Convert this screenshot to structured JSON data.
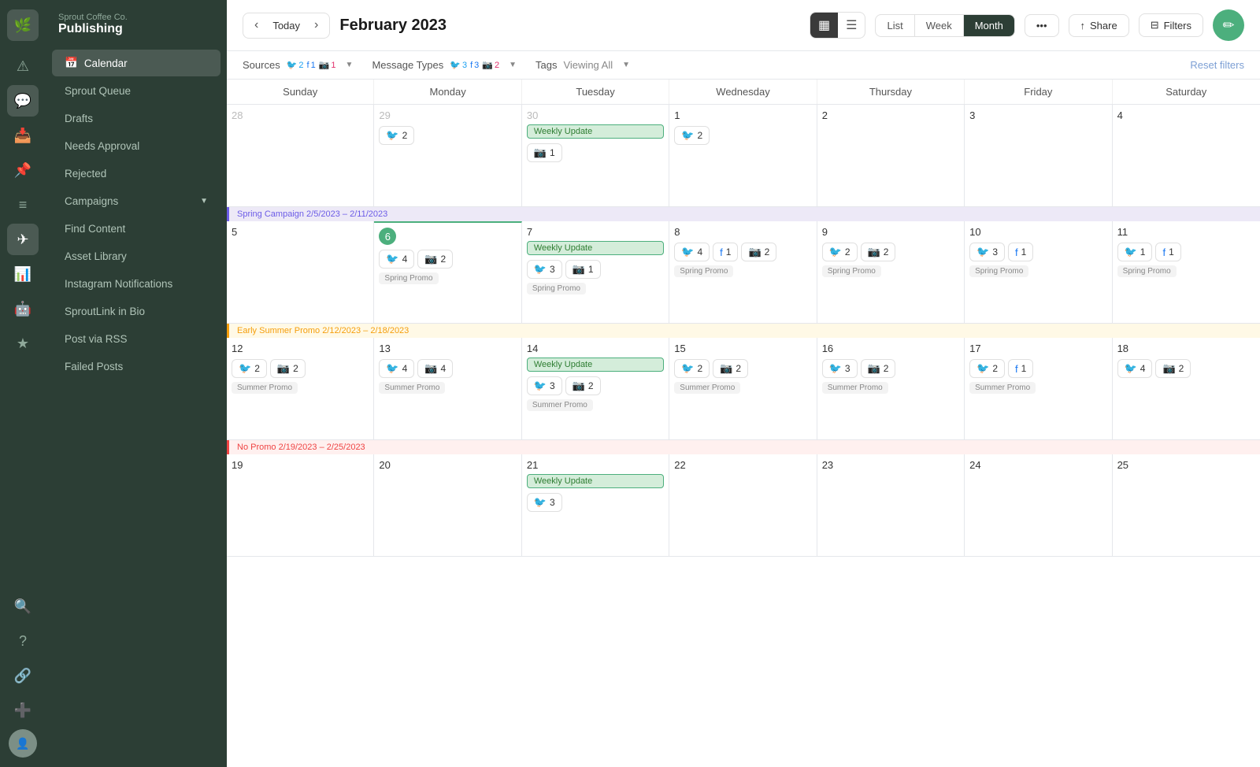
{
  "brand": {
    "company": "Sprout Coffee Co.",
    "app": "Publishing"
  },
  "nav": {
    "items": [
      {
        "id": "calendar",
        "label": "Calendar",
        "active": true
      },
      {
        "id": "sprout-queue",
        "label": "Sprout Queue",
        "active": false
      },
      {
        "id": "drafts",
        "label": "Drafts",
        "active": false
      },
      {
        "id": "needs-approval",
        "label": "Needs Approval",
        "active": false
      },
      {
        "id": "rejected",
        "label": "Rejected",
        "active": false
      },
      {
        "id": "campaigns",
        "label": "Campaigns",
        "active": false,
        "hasChevron": true
      },
      {
        "id": "find-content",
        "label": "Find Content",
        "active": false
      },
      {
        "id": "asset-library",
        "label": "Asset Library",
        "active": false
      },
      {
        "id": "instagram-notifications",
        "label": "Instagram Notifications",
        "active": false
      },
      {
        "id": "sproutlink",
        "label": "SproutLink in Bio",
        "active": false
      },
      {
        "id": "post-via-rss",
        "label": "Post via RSS",
        "active": false
      },
      {
        "id": "failed-posts",
        "label": "Failed Posts",
        "active": false
      }
    ]
  },
  "header": {
    "month_title": "February 2023",
    "today_label": "Today",
    "view_options": [
      "List",
      "Week",
      "Month"
    ],
    "active_view": "Month",
    "share_label": "Share",
    "filters_label": "Filters"
  },
  "filters": {
    "sources_label": "Sources",
    "sources_twitter": "2",
    "sources_facebook": "1",
    "sources_instagram": "1",
    "message_types_label": "Message Types",
    "mt_twitter": "3",
    "mt_facebook": "3",
    "mt_instagram": "2",
    "tags_label": "Tags",
    "tags_value": "Viewing All",
    "reset_label": "Reset filters"
  },
  "days_of_week": [
    "Sunday",
    "Monday",
    "Tuesday",
    "Wednesday",
    "Thursday",
    "Friday",
    "Saturday"
  ],
  "campaigns": {
    "spring": "Spring Campaign 2/5/2023 – 2/11/2023",
    "early_summer": "Early Summer Promo 2/12/2023 – 2/18/2023",
    "no_promo": "No Promo 2/19/2023 – 2/25/2023"
  },
  "weeks": [
    {
      "id": "week0",
      "days": [
        {
          "date": "28",
          "other_month": true,
          "posts": []
        },
        {
          "date": "29",
          "other_month": true,
          "posts": [
            {
              "type": "tw",
              "count": "2"
            }
          ]
        },
        {
          "date": "30",
          "other_month": true,
          "has_event": true,
          "event_label": "Weekly Update",
          "posts": [
            {
              "type": "ig",
              "count": "1"
            }
          ]
        },
        {
          "date": "1",
          "other_month": false,
          "posts": [
            {
              "type": "tw",
              "count": "2"
            }
          ]
        },
        {
          "date": "2",
          "other_month": false,
          "posts": []
        },
        {
          "date": "3",
          "other_month": false,
          "posts": []
        },
        {
          "date": "4",
          "other_month": false,
          "posts": []
        }
      ]
    },
    {
      "id": "week1",
      "campaign": {
        "label": "Spring Campaign 2/5/2023 – 2/11/2023",
        "type": "spring",
        "startCol": 1,
        "endCol": 7
      },
      "days": [
        {
          "date": "5",
          "other_month": false,
          "posts": []
        },
        {
          "date": "6",
          "other_month": false,
          "today": true,
          "posts": [
            {
              "type": "tw",
              "count": "4"
            },
            {
              "type": "ig",
              "count": "2",
              "promo": "Spring Promo"
            }
          ]
        },
        {
          "date": "7",
          "other_month": false,
          "has_event": true,
          "event_label": "Weekly Update",
          "posts": [
            {
              "type": "tw",
              "count": "3"
            },
            {
              "type": "ig",
              "count": "1",
              "promo": "Spring Promo"
            }
          ]
        },
        {
          "date": "8",
          "other_month": false,
          "posts": [
            {
              "type": "tw",
              "count": "4"
            },
            {
              "type": "fb",
              "count": "1"
            },
            {
              "type": "ig",
              "count": "2",
              "promo": "Spring Promo"
            }
          ]
        },
        {
          "date": "9",
          "other_month": false,
          "posts": [
            {
              "type": "tw",
              "count": "2"
            },
            {
              "type": "ig",
              "count": "2",
              "promo": "Spring Promo"
            }
          ]
        },
        {
          "date": "10",
          "other_month": false,
          "posts": [
            {
              "type": "tw",
              "count": "3"
            },
            {
              "type": "fb",
              "count": "1",
              "promo": "Spring Promo"
            }
          ]
        },
        {
          "date": "11",
          "other_month": false,
          "posts": [
            {
              "type": "tw",
              "count": "1"
            },
            {
              "type": "fb",
              "count": "1",
              "promo": "Spring Promo"
            }
          ]
        }
      ]
    },
    {
      "id": "week2",
      "campaign": {
        "label": "Early Summer Promo 2/12/2023 – 2/18/2023",
        "type": "summer",
        "startCol": 0,
        "endCol": 7
      },
      "days": [
        {
          "date": "12",
          "other_month": false,
          "posts": [
            {
              "type": "tw",
              "count": "2"
            },
            {
              "type": "ig",
              "count": "2",
              "promo": "Summer Promo"
            }
          ]
        },
        {
          "date": "13",
          "other_month": false,
          "posts": [
            {
              "type": "tw",
              "count": "4"
            },
            {
              "type": "ig",
              "count": "4",
              "promo": "Summer Promo"
            }
          ]
        },
        {
          "date": "14",
          "other_month": false,
          "has_event": true,
          "event_label": "Weekly Update",
          "posts": [
            {
              "type": "tw",
              "count": "3"
            },
            {
              "type": "ig",
              "count": "2",
              "promo": "Summer Promo"
            }
          ]
        },
        {
          "date": "15",
          "other_month": false,
          "posts": [
            {
              "type": "tw",
              "count": "2"
            },
            {
              "type": "ig",
              "count": "2",
              "promo": "Summer Promo"
            }
          ]
        },
        {
          "date": "16",
          "other_month": false,
          "posts": [
            {
              "type": "tw",
              "count": "3"
            },
            {
              "type": "ig",
              "count": "2",
              "promo": "Summer Promo"
            }
          ]
        },
        {
          "date": "17",
          "other_month": false,
          "posts": [
            {
              "type": "tw",
              "count": "2"
            },
            {
              "type": "fb",
              "count": "1",
              "promo": "Summer Promo"
            }
          ]
        },
        {
          "date": "18",
          "other_month": false,
          "posts": [
            {
              "type": "tw",
              "count": "4"
            },
            {
              "type": "ig",
              "count": "2"
            }
          ]
        }
      ]
    },
    {
      "id": "week3",
      "campaign": {
        "label": "No Promo 2/19/2023 – 2/25/2023",
        "type": "nopromo",
        "startCol": 0,
        "endCol": 7
      },
      "days": [
        {
          "date": "19",
          "other_month": false,
          "posts": []
        },
        {
          "date": "20",
          "other_month": false,
          "posts": []
        },
        {
          "date": "21",
          "other_month": false,
          "has_event": true,
          "event_label": "Weekly Update",
          "posts": [
            {
              "type": "tw",
              "count": "3"
            }
          ]
        },
        {
          "date": "22",
          "other_month": false,
          "posts": []
        },
        {
          "date": "23",
          "other_month": false,
          "posts": []
        },
        {
          "date": "24",
          "other_month": false,
          "posts": []
        },
        {
          "date": "25",
          "other_month": false,
          "posts": []
        }
      ]
    }
  ]
}
